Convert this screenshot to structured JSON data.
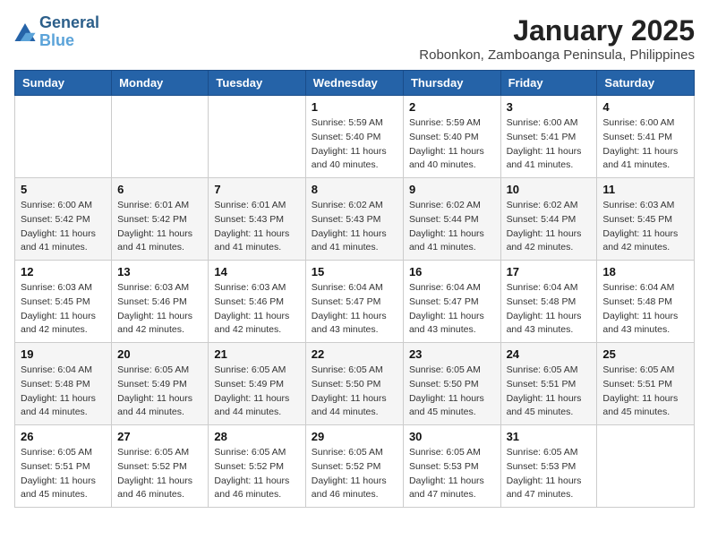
{
  "logo": {
    "line1": "General",
    "line2": "Blue"
  },
  "title": "January 2025",
  "subtitle": "Robonkon, Zamboanga Peninsula, Philippines",
  "days_of_week": [
    "Sunday",
    "Monday",
    "Tuesday",
    "Wednesday",
    "Thursday",
    "Friday",
    "Saturday"
  ],
  "weeks": [
    [
      {
        "day": "",
        "sunrise": "",
        "sunset": "",
        "daylight": ""
      },
      {
        "day": "",
        "sunrise": "",
        "sunset": "",
        "daylight": ""
      },
      {
        "day": "",
        "sunrise": "",
        "sunset": "",
        "daylight": ""
      },
      {
        "day": "1",
        "sunrise": "Sunrise: 5:59 AM",
        "sunset": "Sunset: 5:40 PM",
        "daylight": "Daylight: 11 hours and 40 minutes."
      },
      {
        "day": "2",
        "sunrise": "Sunrise: 5:59 AM",
        "sunset": "Sunset: 5:40 PM",
        "daylight": "Daylight: 11 hours and 40 minutes."
      },
      {
        "day": "3",
        "sunrise": "Sunrise: 6:00 AM",
        "sunset": "Sunset: 5:41 PM",
        "daylight": "Daylight: 11 hours and 41 minutes."
      },
      {
        "day": "4",
        "sunrise": "Sunrise: 6:00 AM",
        "sunset": "Sunset: 5:41 PM",
        "daylight": "Daylight: 11 hours and 41 minutes."
      }
    ],
    [
      {
        "day": "5",
        "sunrise": "Sunrise: 6:00 AM",
        "sunset": "Sunset: 5:42 PM",
        "daylight": "Daylight: 11 hours and 41 minutes."
      },
      {
        "day": "6",
        "sunrise": "Sunrise: 6:01 AM",
        "sunset": "Sunset: 5:42 PM",
        "daylight": "Daylight: 11 hours and 41 minutes."
      },
      {
        "day": "7",
        "sunrise": "Sunrise: 6:01 AM",
        "sunset": "Sunset: 5:43 PM",
        "daylight": "Daylight: 11 hours and 41 minutes."
      },
      {
        "day": "8",
        "sunrise": "Sunrise: 6:02 AM",
        "sunset": "Sunset: 5:43 PM",
        "daylight": "Daylight: 11 hours and 41 minutes."
      },
      {
        "day": "9",
        "sunrise": "Sunrise: 6:02 AM",
        "sunset": "Sunset: 5:44 PM",
        "daylight": "Daylight: 11 hours and 41 minutes."
      },
      {
        "day": "10",
        "sunrise": "Sunrise: 6:02 AM",
        "sunset": "Sunset: 5:44 PM",
        "daylight": "Daylight: 11 hours and 42 minutes."
      },
      {
        "day": "11",
        "sunrise": "Sunrise: 6:03 AM",
        "sunset": "Sunset: 5:45 PM",
        "daylight": "Daylight: 11 hours and 42 minutes."
      }
    ],
    [
      {
        "day": "12",
        "sunrise": "Sunrise: 6:03 AM",
        "sunset": "Sunset: 5:45 PM",
        "daylight": "Daylight: 11 hours and 42 minutes."
      },
      {
        "day": "13",
        "sunrise": "Sunrise: 6:03 AM",
        "sunset": "Sunset: 5:46 PM",
        "daylight": "Daylight: 11 hours and 42 minutes."
      },
      {
        "day": "14",
        "sunrise": "Sunrise: 6:03 AM",
        "sunset": "Sunset: 5:46 PM",
        "daylight": "Daylight: 11 hours and 42 minutes."
      },
      {
        "day": "15",
        "sunrise": "Sunrise: 6:04 AM",
        "sunset": "Sunset: 5:47 PM",
        "daylight": "Daylight: 11 hours and 43 minutes."
      },
      {
        "day": "16",
        "sunrise": "Sunrise: 6:04 AM",
        "sunset": "Sunset: 5:47 PM",
        "daylight": "Daylight: 11 hours and 43 minutes."
      },
      {
        "day": "17",
        "sunrise": "Sunrise: 6:04 AM",
        "sunset": "Sunset: 5:48 PM",
        "daylight": "Daylight: 11 hours and 43 minutes."
      },
      {
        "day": "18",
        "sunrise": "Sunrise: 6:04 AM",
        "sunset": "Sunset: 5:48 PM",
        "daylight": "Daylight: 11 hours and 43 minutes."
      }
    ],
    [
      {
        "day": "19",
        "sunrise": "Sunrise: 6:04 AM",
        "sunset": "Sunset: 5:48 PM",
        "daylight": "Daylight: 11 hours and 44 minutes."
      },
      {
        "day": "20",
        "sunrise": "Sunrise: 6:05 AM",
        "sunset": "Sunset: 5:49 PM",
        "daylight": "Daylight: 11 hours and 44 minutes."
      },
      {
        "day": "21",
        "sunrise": "Sunrise: 6:05 AM",
        "sunset": "Sunset: 5:49 PM",
        "daylight": "Daylight: 11 hours and 44 minutes."
      },
      {
        "day": "22",
        "sunrise": "Sunrise: 6:05 AM",
        "sunset": "Sunset: 5:50 PM",
        "daylight": "Daylight: 11 hours and 44 minutes."
      },
      {
        "day": "23",
        "sunrise": "Sunrise: 6:05 AM",
        "sunset": "Sunset: 5:50 PM",
        "daylight": "Daylight: 11 hours and 45 minutes."
      },
      {
        "day": "24",
        "sunrise": "Sunrise: 6:05 AM",
        "sunset": "Sunset: 5:51 PM",
        "daylight": "Daylight: 11 hours and 45 minutes."
      },
      {
        "day": "25",
        "sunrise": "Sunrise: 6:05 AM",
        "sunset": "Sunset: 5:51 PM",
        "daylight": "Daylight: 11 hours and 45 minutes."
      }
    ],
    [
      {
        "day": "26",
        "sunrise": "Sunrise: 6:05 AM",
        "sunset": "Sunset: 5:51 PM",
        "daylight": "Daylight: 11 hours and 45 minutes."
      },
      {
        "day": "27",
        "sunrise": "Sunrise: 6:05 AM",
        "sunset": "Sunset: 5:52 PM",
        "daylight": "Daylight: 11 hours and 46 minutes."
      },
      {
        "day": "28",
        "sunrise": "Sunrise: 6:05 AM",
        "sunset": "Sunset: 5:52 PM",
        "daylight": "Daylight: 11 hours and 46 minutes."
      },
      {
        "day": "29",
        "sunrise": "Sunrise: 6:05 AM",
        "sunset": "Sunset: 5:52 PM",
        "daylight": "Daylight: 11 hours and 46 minutes."
      },
      {
        "day": "30",
        "sunrise": "Sunrise: 6:05 AM",
        "sunset": "Sunset: 5:53 PM",
        "daylight": "Daylight: 11 hours and 47 minutes."
      },
      {
        "day": "31",
        "sunrise": "Sunrise: 6:05 AM",
        "sunset": "Sunset: 5:53 PM",
        "daylight": "Daylight: 11 hours and 47 minutes."
      },
      {
        "day": "",
        "sunrise": "",
        "sunset": "",
        "daylight": ""
      }
    ]
  ]
}
